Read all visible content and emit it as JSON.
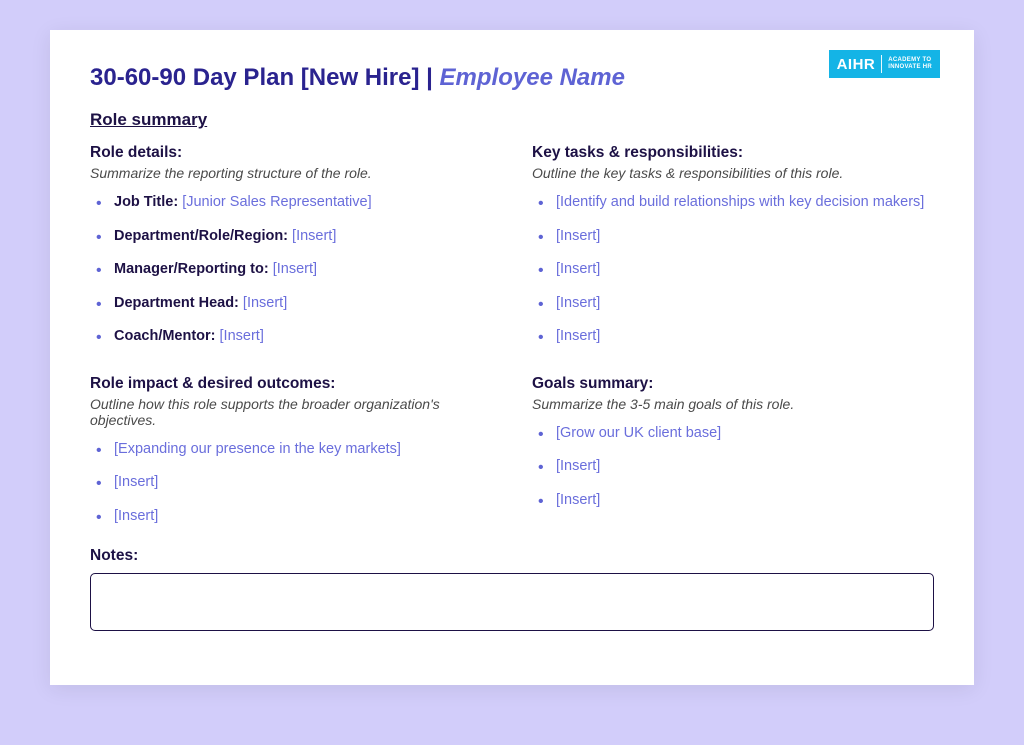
{
  "logo": {
    "main": "AIHR",
    "sub": "ACADEMY TO\nINNOVATE HR"
  },
  "title": {
    "plan": "30-60-90 Day Plan [New Hire] | ",
    "employee": "Employee Name"
  },
  "section_title": "Role summary",
  "role_details": {
    "heading": "Role details:",
    "desc": "Summarize the reporting structure of the role.",
    "items": [
      {
        "label": "Job Title: ",
        "value": "[Junior Sales Representative]"
      },
      {
        "label": "Department/Role/Region: ",
        "value": "[Insert]"
      },
      {
        "label": "Manager/Reporting to: ",
        "value": "[Insert]"
      },
      {
        "label": "Department Head: ",
        "value": "[Insert]"
      },
      {
        "label": "Coach/Mentor: ",
        "value": "[Insert]"
      }
    ]
  },
  "key_tasks": {
    "heading": "Key tasks & responsibilities:",
    "desc": "Outline the key tasks & responsibilities of this role.",
    "items": [
      "[Identify and build relationships with key decision makers]",
      "[Insert]",
      "[Insert]",
      "[Insert]",
      "[Insert]"
    ]
  },
  "role_impact": {
    "heading": "Role impact & desired outcomes:",
    "desc": "Outline how this role supports the broader organization's objectives.",
    "items": [
      "[Expanding our presence in the key markets]",
      "[Insert]",
      "[Insert]"
    ]
  },
  "goals": {
    "heading": "Goals summary:",
    "desc": "Summarize the 3-5 main goals of this role.",
    "items": [
      "[Grow our UK client base]",
      "[Insert]",
      "[Insert]"
    ]
  },
  "notes": {
    "heading": "Notes:",
    "value": ""
  }
}
